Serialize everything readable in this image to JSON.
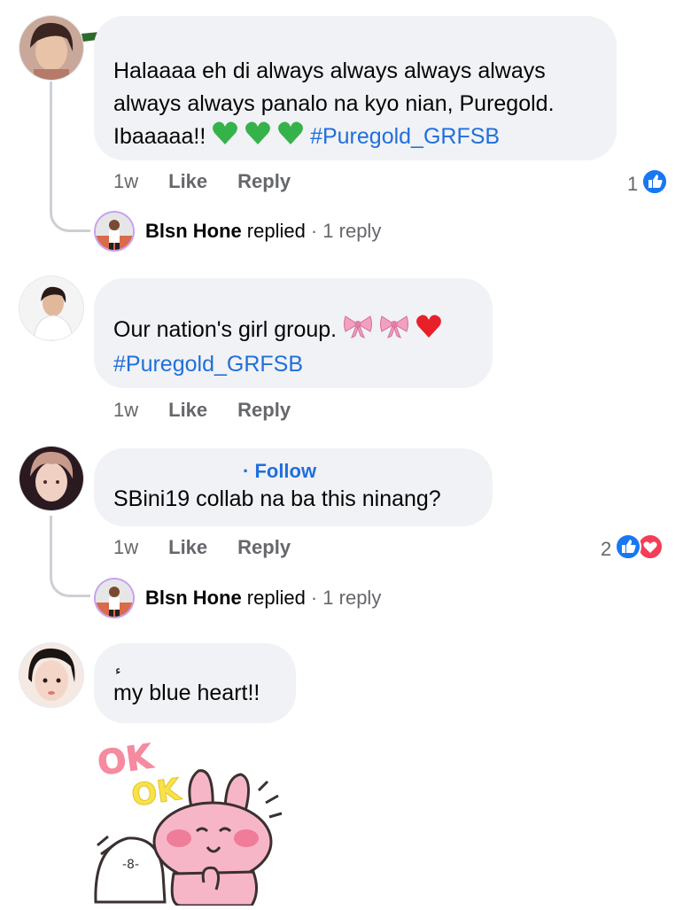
{
  "comments": [
    {
      "text_parts": [
        {
          "text": "Halaaaa eh di always always always always always always panalo na kyo nian, Puregold. Ibaaaaa!! "
        },
        {
          "emoji": [
            "green-heart",
            "green-heart",
            "green-heart"
          ]
        },
        {
          "text": " #Puregold_GRFSB",
          "hashtag": true
        }
      ],
      "line1": "Halaaaa eh di always always always always",
      "line2": "always always panalo na kyo nian, Puregold.",
      "line3": "Ibaaaaa!!",
      "hashtag": "#Puregold_GRFSB",
      "time": "1w",
      "like": "Like",
      "reply": "Reply",
      "reaction_count": "1",
      "replied_by": "Blsn Hone",
      "replied_word": "replied",
      "reply_count": "· 1 reply"
    },
    {
      "line1": "Our nation's girl group.",
      "hashtag": "#Puregold_GRFSB",
      "time": "1w",
      "like": "Like",
      "reply": "Reply"
    },
    {
      "follow": "· Follow",
      "line1": "SBini19 collab na ba this ninang?",
      "time": "1w",
      "like": "Like",
      "reply": "Reply",
      "reaction_count": "2",
      "replied_by": "Blsn Hone",
      "replied_word": "replied",
      "reply_count": "· 1 reply"
    },
    {
      "small_char": "ء",
      "line1": "my blue heart!!",
      "sticker_text1": "OK",
      "sticker_text2": "OK"
    }
  ],
  "colors": {
    "bubble": "#f0f2f5",
    "link": "#216fdb",
    "meta": "#65676b",
    "like_blue": "#1877f2",
    "love_red": "#f33e58"
  }
}
